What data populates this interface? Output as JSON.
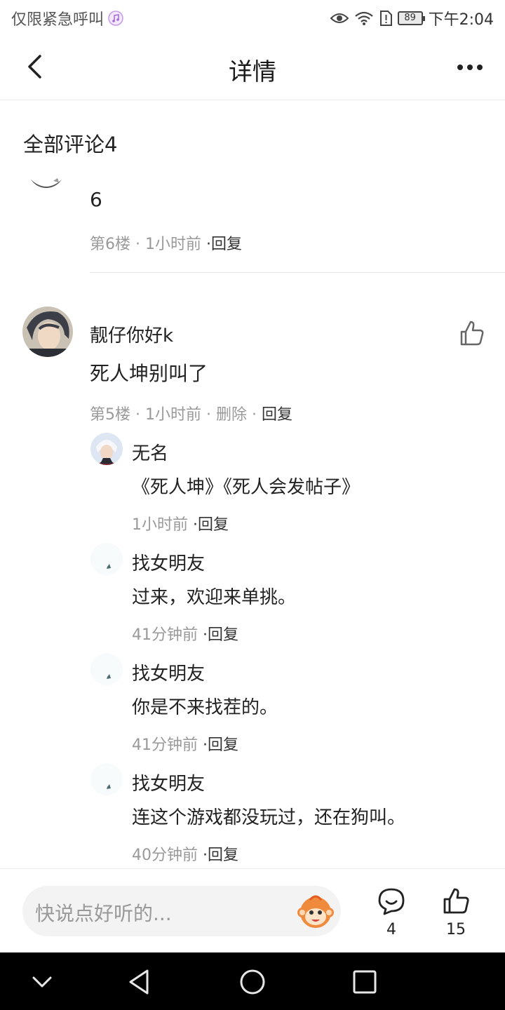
{
  "status_bar": {
    "left_text": "仅限紧急呼叫",
    "battery": "89",
    "time": "下午2:04"
  },
  "header": {
    "title": "详情"
  },
  "comments_section": {
    "title": "全部评论4"
  },
  "comments": [
    {
      "text": "6",
      "floor": "第6楼",
      "time": "1小时前",
      "reply": "·回复"
    },
    {
      "author": "靓仔你好k",
      "text": "死人坤别叫了",
      "floor": "第5楼",
      "time": "1小时前",
      "delete": "删除",
      "reply": "回复",
      "replies": [
        {
          "author": "无名",
          "text": "《死人坤》《死人会发帖子》",
          "time": "1小时前",
          "reply": "·回复"
        },
        {
          "author": "找女明友",
          "text": "过来，欢迎来单挑。",
          "time": "41分钟前",
          "reply": "·回复"
        },
        {
          "author": "找女明友",
          "text": "你是不来找茬的。",
          "time": "41分钟前",
          "reply": "·回复"
        },
        {
          "author": "找女明友",
          "text": "连这个游戏都没玩过，还在狗叫。",
          "time": "40分钟前",
          "reply": "·回复"
        }
      ]
    }
  ],
  "bottom_bar": {
    "input_placeholder": "快说点好听的...",
    "comment_count": "4",
    "like_count": "15"
  },
  "icons": {
    "back": "chevron-left-icon",
    "more": "more-dots-icon",
    "like": "thumb-up-icon",
    "comment": "comment-bubble-icon",
    "emoji": "monkey-emoji-icon"
  },
  "colors": {
    "primary_text": "#222222",
    "meta_text": "#999999",
    "input_bg": "#f3f3f3",
    "nav_bg": "#000000"
  }
}
